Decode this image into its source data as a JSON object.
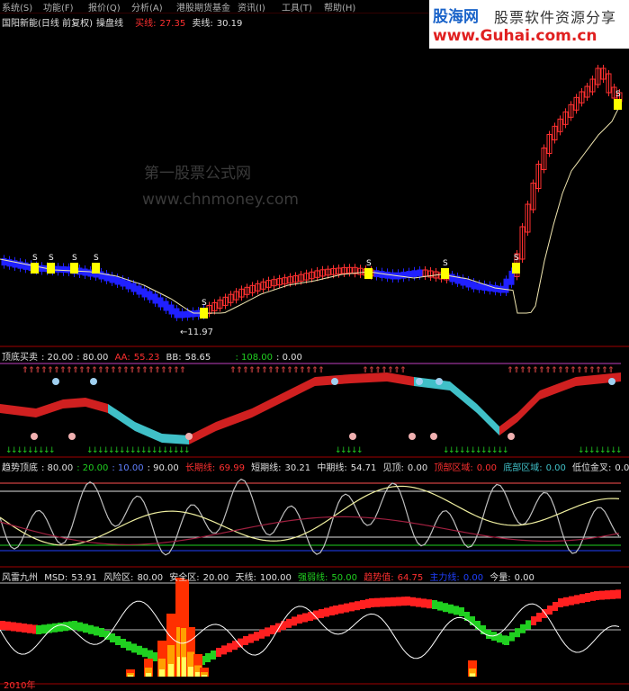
{
  "menu": [
    "系统(S)",
    "功能(F)",
    "报价(Q)",
    "分析(A)",
    "港股期货基金",
    "资讯(I)",
    "工具(T)",
    "帮助(H)"
  ],
  "brand": {
    "name": "股海网",
    "slogan": "股票软件资源分享",
    "url": "www.Guhai.com.cn"
  },
  "watermark": {
    "line1": "第一股票公式网",
    "line2": "www.chnmoney.com"
  },
  "panel1": {
    "title": "国阳新能(日线 前复权)",
    "indicator": "操盘线",
    "buy_label": "买线:",
    "buy_value": "27.35",
    "sell_label": "卖线:",
    "sell_value": "30.19",
    "low_marker": "←11.97",
    "signal": "S"
  },
  "panel2": {
    "title": "顶底买卖",
    "p1": ": 20.00",
    "p2": ": 80.00",
    "aa_label": "AA:",
    "aa_value": "55.23",
    "bb_label": "BB:",
    "bb_value": "58.65",
    "v3": ": 108.00",
    "v4": ": 0.00"
  },
  "panel3": {
    "title": "趋势顶底",
    "p1": ": 80.00",
    "p2": ": 20.00",
    "p3": ": 10.00",
    "p4": ": 90.00",
    "long_label": "长期线:",
    "long_value": "69.99",
    "short_label": "短期线:",
    "short_value": "30.21",
    "mid_label": "中期线:",
    "mid_value": "54.71",
    "top_label": "见顶:",
    "top_value": "0.00",
    "risk_label": "顶部区域:",
    "risk_value": "0.00",
    "bottom_label": "底部区域:",
    "bottom_value": "0.00",
    "gold_label": "低位金叉:",
    "gold_value": "0.00"
  },
  "panel4": {
    "title": "风雷九州",
    "msd_label": "MSD:",
    "msd_value": "53.91",
    "risk_label": "风险区:",
    "risk_value": "80.00",
    "safe_label": "安全区:",
    "safe_value": "20.00",
    "sky_label": "天线:",
    "sky_value": "100.00",
    "strong_label": "强弱线:",
    "strong_value": "50.00",
    "trend_label": "趋势值:",
    "trend_value": "64.75",
    "vol_label": "主力线:",
    "vol_value": "0.00",
    "today_label": "今量:",
    "today_value": "0.00"
  },
  "footer": {
    "date": "2010年"
  },
  "colors": {
    "up": "#ff3030",
    "down": "#2020ff",
    "yellow": "#ffff00",
    "cyan": "#40c0c8",
    "green": "#20d020",
    "magenta": "#ff40ff",
    "white": "#ffffff"
  }
}
